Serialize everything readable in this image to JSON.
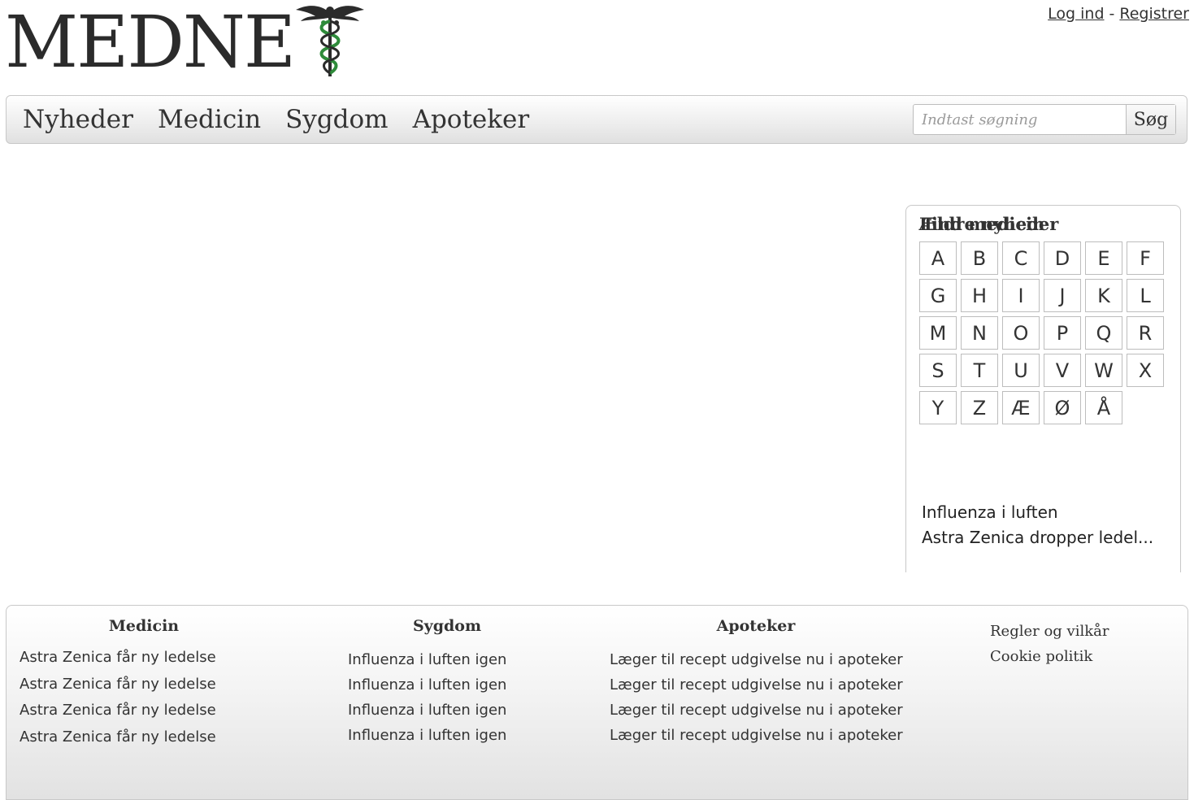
{
  "header": {
    "logo_text": "MEDNE",
    "login_label": "Log ind",
    "separator": "-",
    "register_label": "Registrer"
  },
  "nav": {
    "items": [
      {
        "label": "Nyheder"
      },
      {
        "label": "Medicin"
      },
      {
        "label": "Sygdom"
      },
      {
        "label": "Apoteker"
      }
    ],
    "search_placeholder": "Indtast søgning",
    "search_button": "Søg"
  },
  "sidebar": {
    "find_title": "Find medicin",
    "letters": [
      "A",
      "B",
      "C",
      "D",
      "E",
      "F",
      "G",
      "H",
      "I",
      "J",
      "K",
      "L",
      "M",
      "N",
      "O",
      "P",
      "Q",
      "R",
      "S",
      "T",
      "U",
      "V",
      "W",
      "X",
      "Y",
      "Z",
      "Æ",
      "Ø",
      "Å"
    ],
    "older_title": "Ældre nyheder",
    "older_items": [
      "Influenza i luften",
      "Astra Zenica dropper ledel..."
    ]
  },
  "footer": {
    "medicin": {
      "title": "Medicin",
      "links": [
        "Astra Zenica får ny ledelse",
        "Astra Zenica får ny ledelse",
        "Astra Zenica får ny ledelse",
        "Astra Zenica får ny ledelse"
      ]
    },
    "sygdom": {
      "title": "Sygdom",
      "links": [
        "Influenza i luften igen",
        "Influenza i luften igen",
        "Influenza i luften igen",
        "Influenza i luften igen"
      ]
    },
    "apoteker": {
      "title": "Apoteker",
      "links": [
        "Læger til recept udgivelse nu i apoteker",
        "Læger til recept udgivelse nu i apoteker",
        "Læger til recept udgivelse nu i apoteker",
        "Læger til recept udgivelse nu i apoteker"
      ]
    },
    "legal": [
      "Regler og vilkår",
      "Cookie politik"
    ]
  },
  "colors": {
    "logo_text": "#2b2b2b",
    "caduceus_green": "#2e8b3a",
    "border": "#c8c8c8"
  },
  "icons": {
    "logo_symbol": "caduceus-icon"
  }
}
